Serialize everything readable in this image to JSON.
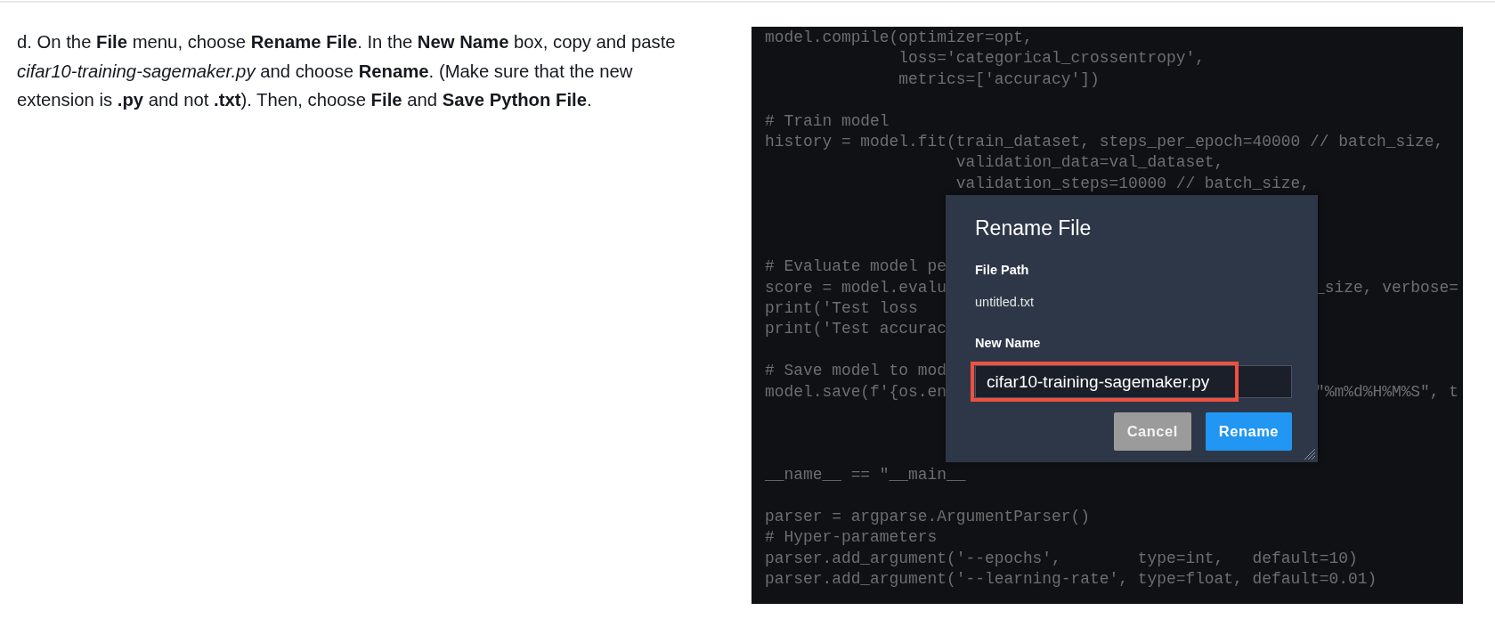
{
  "instruction": "d. On the **File** menu, choose **Rename File**. In the **New Name** box, copy and paste *cifar10-training-sagemaker.py* and choose **Rename**. (Make sure that the new extension is **.py** and not **.txt**). Then, choose **File** and **Save Python File**.",
  "screenshot": {
    "code_lines": [
      {
        "kind": "code",
        "text": "model.compile(optimizer=opt,"
      },
      {
        "kind": "code",
        "text": "              loss='categorical_crossentropy',"
      },
      {
        "kind": "code",
        "text": "              metrics=['accuracy'])"
      },
      {
        "kind": "blank"
      },
      {
        "kind": "code",
        "text": "# Train model"
      },
      {
        "kind": "code",
        "text": "history = model.fit(train_dataset, steps_per_epoch=40000 // batch_size,"
      },
      {
        "kind": "code",
        "text": "                    validation_data=val_dataset,"
      },
      {
        "kind": "code",
        "text": "                    validation_steps=10000 // batch_size,"
      },
      {
        "kind": "blank"
      },
      {
        "kind": "blank"
      },
      {
        "kind": "blank"
      },
      {
        "kind": "code",
        "text": "# Evaluate model pe"
      },
      {
        "kind": "code",
        "text": "score = model.evalu",
        "right": "_size, verbose="
      },
      {
        "kind": "code",
        "text": "print('Test loss"
      },
      {
        "kind": "code",
        "text": "print('Test accurac"
      },
      {
        "kind": "blank"
      },
      {
        "kind": "code",
        "text": "# Save model to mod"
      },
      {
        "kind": "code",
        "text": "model.save(f'{os.en",
        "right": "\"%m%d%H%M%S\", t"
      },
      {
        "kind": "blank"
      },
      {
        "kind": "blank"
      },
      {
        "kind": "blank"
      },
      {
        "kind": "code",
        "text": "__name__ == \"__main__"
      },
      {
        "kind": "blank"
      },
      {
        "kind": "code",
        "text": "parser = argparse.ArgumentParser()"
      },
      {
        "kind": "code",
        "text": "# Hyper-parameters"
      },
      {
        "kind": "code",
        "text": "parser.add_argument('--epochs',        type=int,   default=10)"
      },
      {
        "kind": "code",
        "text": "parser.add_argument('--learning-rate', type=float, default=0.01)"
      }
    ],
    "dialog": {
      "title": "Rename File",
      "file_path_label": "File Path",
      "file_path": "untitled.txt",
      "new_name_label": "New Name",
      "new_name": {
        "value": "cifar10-training-sagemaker.py",
        "highlighted": true
      },
      "buttons": [
        {
          "kind": "secondary",
          "label": "Cancel"
        },
        {
          "kind": "primary",
          "label": "Rename"
        }
      ]
    }
  }
}
